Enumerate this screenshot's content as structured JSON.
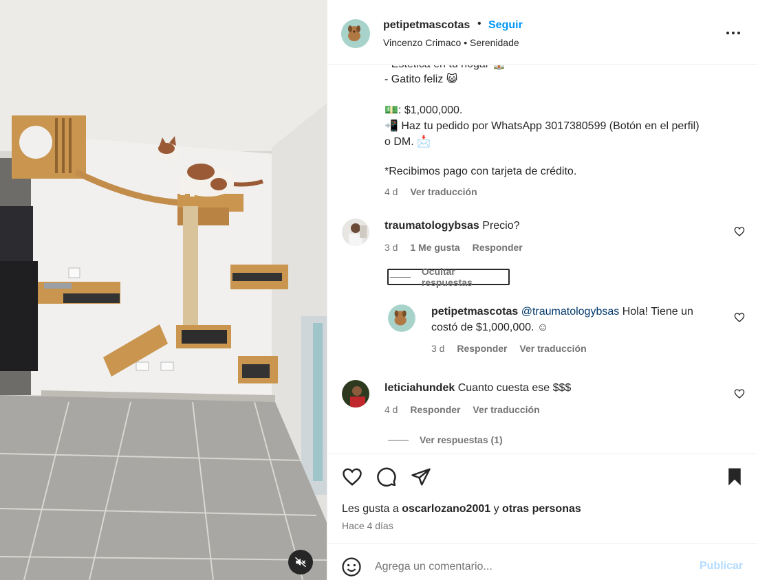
{
  "post": {
    "username": "petipetmascotas",
    "dot": "•",
    "follow_label": "Seguir",
    "subtitle": "Vincenzo Crimaco • Serenidade",
    "more_label": "..."
  },
  "caption": {
    "lines": [
      "- Estética en tu hogar 🏠",
      "- Gatito feliz 😺",
      "💵: $1,000,000.",
      "📲 Haz tu pedido por WhatsApp 3017380599 (Botón en el perfil)",
      "o DM. 📩",
      "*Recibimos pago con tarjeta de crédito."
    ],
    "time": "4 d",
    "translate": "Ver traducción"
  },
  "comments": [
    {
      "username": "traumatologybsas",
      "text": "Precio?",
      "time": "3 d",
      "likes": "1 Me gusta",
      "reply": "Responder",
      "toggle": "Ocultar respuestas"
    },
    {
      "username": "petipetmascotas",
      "mention": "@traumatologybsas",
      "text1": "Hola! Tiene un",
      "text2": "costó de $1,000,000. ☺",
      "time": "3 d",
      "reply": "Responder",
      "translate": "Ver traducción"
    },
    {
      "username": "leticiahundek",
      "text": "Cuanto cuesta ese $$$",
      "time": "4 d",
      "reply": "Responder",
      "translate": "Ver traducción",
      "toggle": "Ver respuestas (1)"
    }
  ],
  "likes": {
    "prefix": "Les gusta a",
    "user": "oscarlozano2001",
    "joiner": "y",
    "others": "otras personas",
    "date": "Hace 4 días"
  },
  "composer": {
    "placeholder": "Agrega un comentario...",
    "publish": "Publicar"
  },
  "icons": {
    "like": "heart-icon",
    "comment": "comment-icon",
    "share": "paper-plane-icon",
    "save": "bookmark-filled-icon",
    "emoji": "smiley-icon",
    "mute": "speaker-muted-icon",
    "more": "more-horizontal-icon"
  },
  "colors": {
    "accent": "#0095f6",
    "text": "#262626",
    "muted": "#737373",
    "publish_disabled": "#b3dbff"
  }
}
